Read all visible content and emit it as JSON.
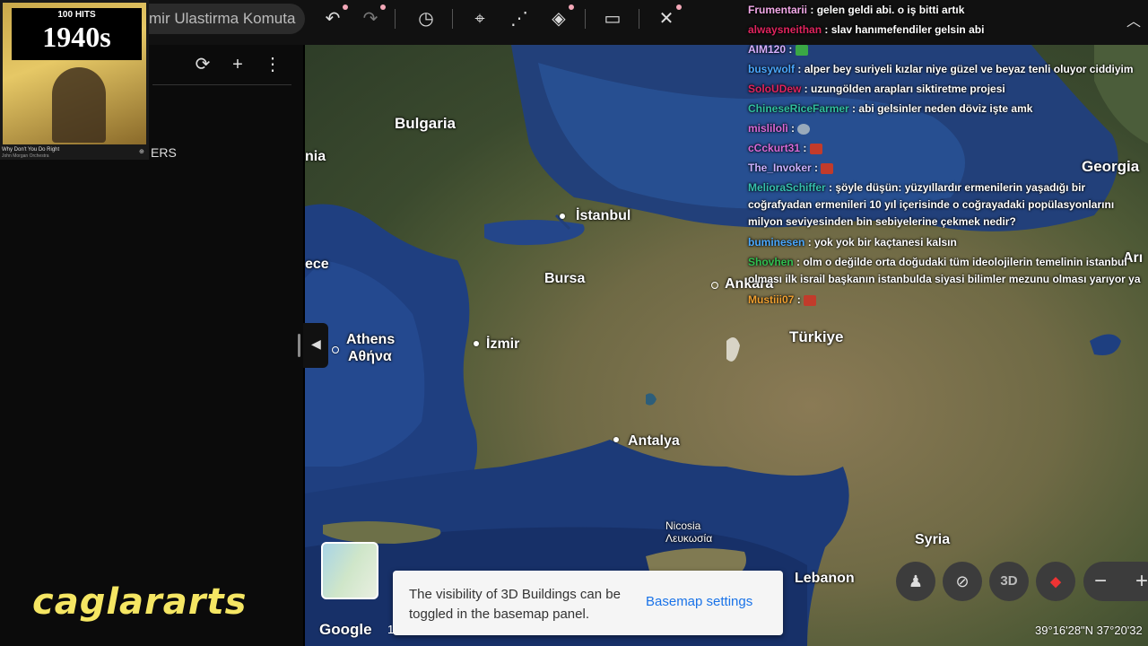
{
  "toolbar": {
    "search_text": "mir Ulastirma Komuta",
    "icons": [
      "undo-icon",
      "redo-icon",
      "history-icon",
      "pin-icon",
      "path-icon",
      "layers-icon",
      "ruler-icon",
      "tools-icon"
    ]
  },
  "panel": {
    "folder_text": "ERS"
  },
  "album": {
    "hits": "100 HITS",
    "year": "1940s",
    "track": "Why Don't You Do Right",
    "artist": "John Morgan Orchestra"
  },
  "watermark": "caglararts",
  "map_labels": {
    "bulgaria": "Bulgaria",
    "istanbul": "İstanbul",
    "bursa": "Bursa",
    "ankara": "Ankara",
    "turkiye": "Türkiye",
    "izmir": "İzmir",
    "athens": "Athens",
    "athina": "Αθήνα",
    "antalya": "Antalya",
    "nicosia": "Nicosia",
    "lefkosia": "Λευκωσία",
    "syria": "Syria",
    "lebanon": "Lebanon",
    "georgia": "Georgia",
    "greece": "ece",
    "nia": "nia",
    "arm": "Arı"
  },
  "chat": [
    {
      "user": "Frumentarii",
      "color": "#f2a9e8",
      "text": "gelen geldi abi. o iş bitti artık"
    },
    {
      "user": "alwaysneithan",
      "color": "#e0245e",
      "text": "slav hanımefendiler gelsin abi"
    },
    {
      "user": "AIM120",
      "color": "#d6b0ff",
      "text": ""
    },
    {
      "user": "busywolf",
      "color": "#4aa8ff",
      "text": "alper bey suriyeli kızlar niye güzel ve beyaz tenli oluyor ciddiyim"
    },
    {
      "user": "SoloUDew",
      "color": "#e0245e",
      "text": "uzungölden arapları siktiretme projesi"
    },
    {
      "user": "ChineseRiceFarmer",
      "color": "#30c0a0",
      "text": "abi gelsinler neden döviz işte amk"
    },
    {
      "user": "mislilolì",
      "color": "#d96ad9",
      "text": ""
    },
    {
      "user": "cCckurt31",
      "color": "#d96ad9",
      "text": ""
    },
    {
      "user": "The_Invoker",
      "color": "#c9b0ff",
      "text": ""
    },
    {
      "user": "MelioraSchiffer",
      "color": "#35c0b0",
      "text": "şöyle düşün: yüzyıllardır ermenilerin yaşadığı bir coğrafyadan ermenileri 10 yıl içerisinde o coğrayadaki popülasyonlarını milyon seviyesinden bin sebiyelerine çekmek nedir?"
    },
    {
      "user": "buminesen",
      "color": "#4aa8ff",
      "text": "yok yok bir kaçtanesi kalsın"
    },
    {
      "user": "Shovhen",
      "color": "#30c050",
      "text": "olm o değilde orta doğudaki tüm ideolojilerin temelinin istanbul olması ilk israil başkanın istanbulda siyasi bilimler mezunu olması yarıyor ya"
    },
    {
      "user": "Mustiii07",
      "color": "#f0a030",
      "text": ""
    }
  ],
  "toast": {
    "text": "The visibility of 3D Buildings can be toggled in the basemap panel.",
    "button": "Basemap settings"
  },
  "footer": {
    "google": "Google",
    "scale": "1",
    "coords": "39°16'28\"N 37°20'32"
  },
  "controls": {
    "three_d": "3D",
    "zoom_out": "−",
    "zoom_in": "+"
  }
}
